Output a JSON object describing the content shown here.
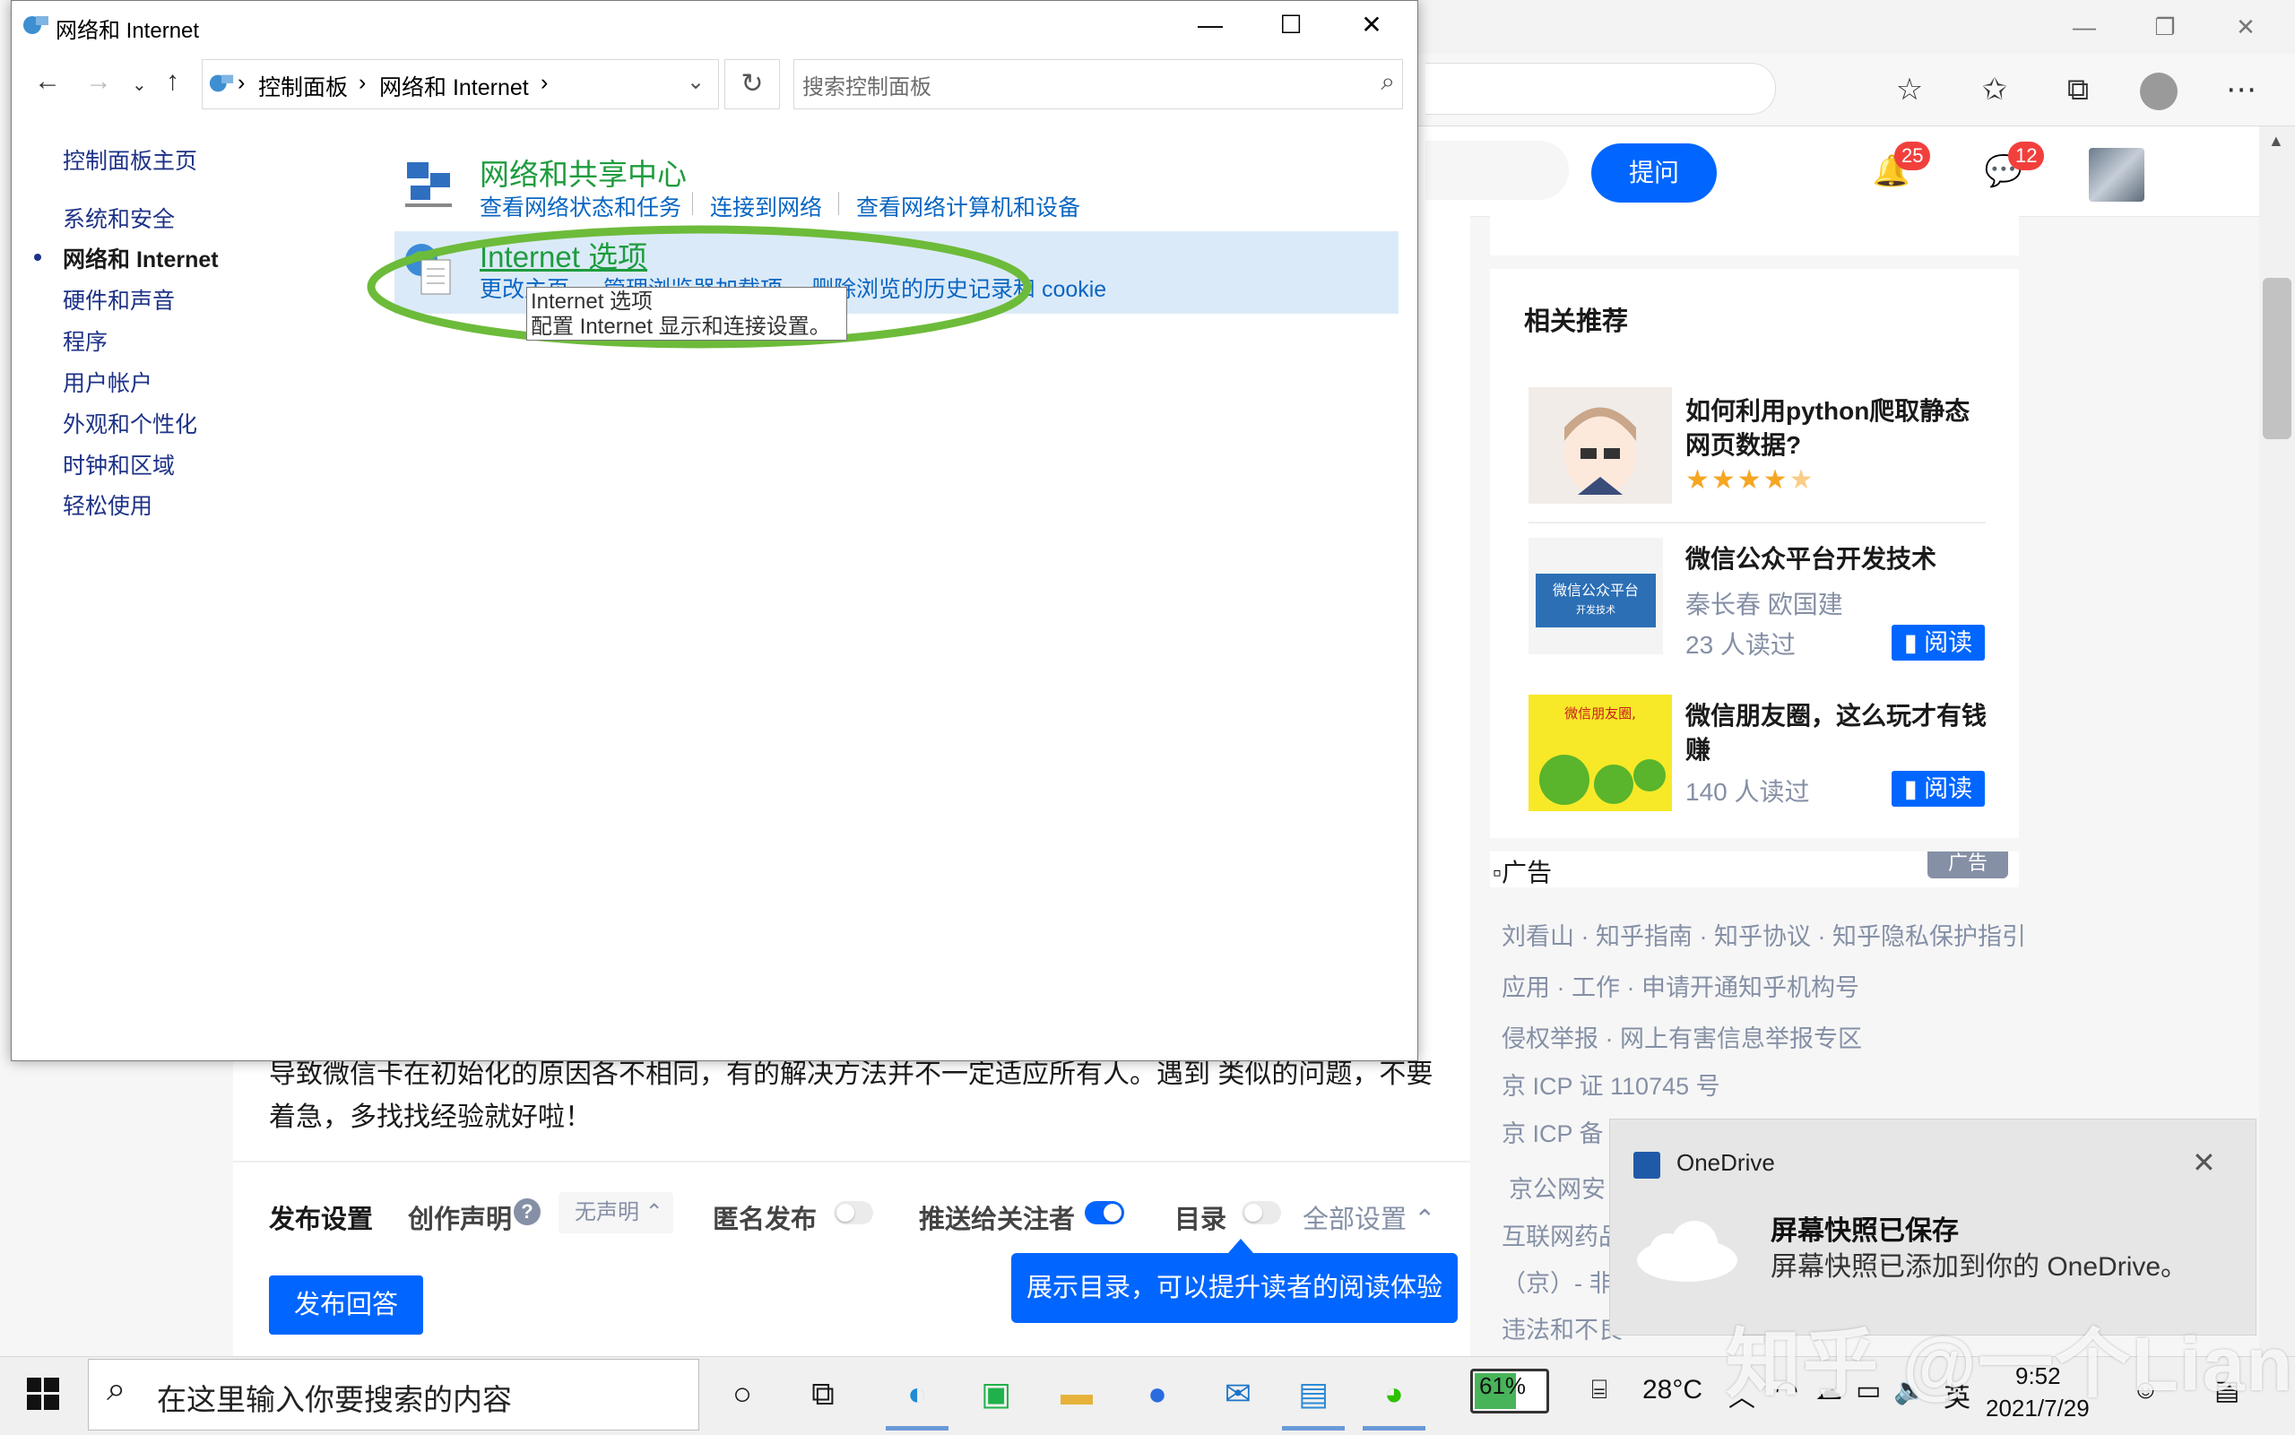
{
  "cp_window": {
    "title": "网络和 Internet",
    "breadcrumb": [
      "控制面板",
      "网络和 Internet"
    ],
    "search_placeholder": "搜索控制面板",
    "nav": [
      "控制面板主页",
      "系统和安全",
      "网络和 Internet",
      "硬件和声音",
      "程序",
      "用户帐户",
      "外观和个性化",
      "时钟和区域",
      "轻松使用"
    ],
    "active_nav": "网络和 Internet",
    "categories": [
      {
        "title": "网络和共享中心",
        "links": [
          "查看网络状态和任务",
          "连接到网络",
          "查看网络计算机和设备"
        ]
      },
      {
        "title": "Internet 选项",
        "links": [
          "更改主页",
          "管理浏览器加载项",
          "删除浏览的历史记录和 cookie"
        ]
      }
    ],
    "tooltip": {
      "title": "Internet 选项",
      "body": "配置 Internet 显示和连接设置。"
    }
  },
  "zhihu": {
    "ask_button": "提问",
    "notifications_count": "25",
    "messages_count": "12",
    "related_title": "相关推荐",
    "recommendations": [
      {
        "title": "如何利用python爬取静态网页数据?",
        "rating": 4.5
      },
      {
        "title": "微信公众平台开发技术",
        "author": "秦长春 欧国建",
        "readers": "23 人读过",
        "read_label": "阅读"
      },
      {
        "title": "微信朋友圈，这么玩才有钱赚",
        "readers": "140 人读过",
        "read_label": "阅读"
      }
    ],
    "ad_text": "广告",
    "ad_tag": "广告",
    "footer_lines": [
      "刘看山 · 知乎指南 · 知乎协议 · 知乎隐私保护指引",
      "应用 · 工作 · 申请开通知乎机构号",
      "侵权举报 · 网上有害信息举报专区",
      "京 ICP 证 110745 号",
      "京 ICP 备",
      "京公网安",
      "互联网药品",
      "（京）- 非",
      "违法和不良"
    ],
    "article_text": "导致微信卡在初始化的原因各不相同，有的解决方法并不一定适应所有人。遇到 类似的问题，不要着急，多找找经验就好啦！",
    "publish": {
      "settings_label": "发布设置",
      "declaration_label": "创作声明",
      "declaration_value": "无声明",
      "anonymous_label": "匿名发布",
      "push_label": "推送给关注者",
      "toc_label": "目录",
      "all_settings": "全部设置",
      "publish_button": "发布回答",
      "toc_tooltip": "展示目录，可以提升读者的阅读体验"
    }
  },
  "toast": {
    "app": "OneDrive",
    "title": "屏幕快照已保存",
    "body": "屏幕快照已添加到你的 OneDrive。"
  },
  "taskbar": {
    "search_text": "在这里输入你要搜索的内容",
    "battery": "61%",
    "battery_level": 0.61,
    "weather": "28°C",
    "ime": "英",
    "time": "9:52",
    "date": "2021/7/29"
  },
  "watermark": "知乎 @一个Liang",
  "colors": {
    "accent": "#0066ff",
    "cp_green_title": "#1e9c3e",
    "cp_link": "#0a66c2",
    "annotation_green": "#6dbb3a"
  }
}
